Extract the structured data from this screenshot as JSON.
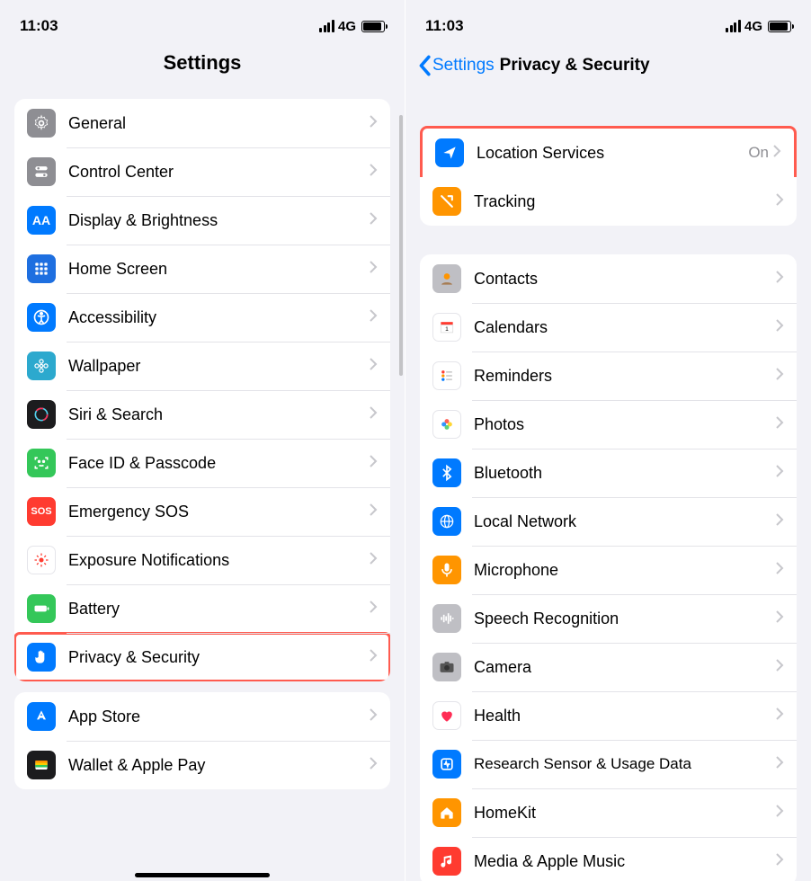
{
  "status": {
    "time": "11:03",
    "network": "4G"
  },
  "left": {
    "title": "Settings",
    "group1": [
      {
        "id": "general",
        "label": "General"
      },
      {
        "id": "control-center",
        "label": "Control Center"
      },
      {
        "id": "display",
        "label": "Display & Brightness"
      },
      {
        "id": "home-screen",
        "label": "Home Screen"
      },
      {
        "id": "accessibility",
        "label": "Accessibility"
      },
      {
        "id": "wallpaper",
        "label": "Wallpaper"
      },
      {
        "id": "siri",
        "label": "Siri & Search"
      },
      {
        "id": "faceid",
        "label": "Face ID & Passcode"
      },
      {
        "id": "sos",
        "label": "Emergency SOS"
      },
      {
        "id": "exposure",
        "label": "Exposure Notifications"
      },
      {
        "id": "battery",
        "label": "Battery"
      },
      {
        "id": "privacy",
        "label": "Privacy & Security"
      }
    ],
    "group2": [
      {
        "id": "appstore",
        "label": "App Store"
      },
      {
        "id": "wallet",
        "label": "Wallet & Apple Pay"
      }
    ]
  },
  "right": {
    "back": "Settings",
    "title": "Privacy & Security",
    "group1": [
      {
        "id": "location",
        "label": "Location Services",
        "value": "On"
      },
      {
        "id": "tracking",
        "label": "Tracking"
      }
    ],
    "group2": [
      {
        "id": "contacts",
        "label": "Contacts"
      },
      {
        "id": "calendars",
        "label": "Calendars"
      },
      {
        "id": "reminders",
        "label": "Reminders"
      },
      {
        "id": "photos",
        "label": "Photos"
      },
      {
        "id": "bluetooth",
        "label": "Bluetooth"
      },
      {
        "id": "localnet",
        "label": "Local Network"
      },
      {
        "id": "microphone",
        "label": "Microphone"
      },
      {
        "id": "speech",
        "label": "Speech Recognition"
      },
      {
        "id": "camera",
        "label": "Camera"
      },
      {
        "id": "health",
        "label": "Health"
      },
      {
        "id": "research",
        "label": "Research Sensor & Usage Data"
      },
      {
        "id": "homekit",
        "label": "HomeKit"
      },
      {
        "id": "media",
        "label": "Media & Apple Music"
      }
    ]
  }
}
